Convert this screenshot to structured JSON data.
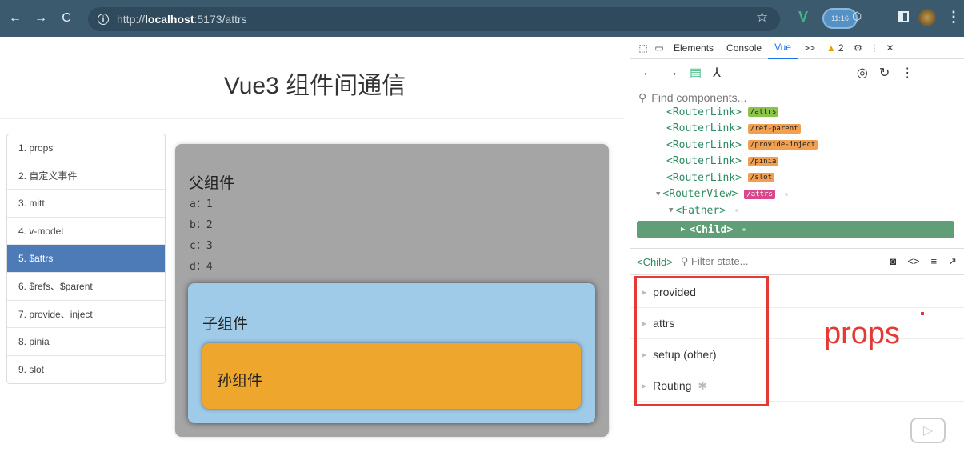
{
  "browser": {
    "back": "←",
    "forward": "→",
    "reload": "C",
    "url_prefix": "http://",
    "url_host": "localhost",
    "url_rest": ":5173/attrs",
    "star": "☆",
    "vue_ext": "V",
    "badge_time": "11:16",
    "menu": "⋮"
  },
  "page": {
    "title": "Vue3 组件间通信",
    "nav": [
      "1. props",
      "2. 自定义事件",
      "3. mitt",
      "4. v-model",
      "5. $attrs",
      "6. $refs、$parent",
      "7. provide、inject",
      "8. pinia",
      "9. slot"
    ],
    "active_index": 4,
    "father": {
      "title": "父组件",
      "items": [
        "a：1",
        "b：2",
        "c：3",
        "d：4"
      ]
    },
    "child": {
      "title": "子组件"
    },
    "grandchild": {
      "title": "孙组件"
    }
  },
  "devtools": {
    "tabs": [
      "Elements",
      "Console",
      "Vue",
      ">>"
    ],
    "active_tab": "Vue",
    "warning_count": "2",
    "search_placeholder": "Find components...",
    "tree": [
      {
        "label": "<RouterLink>",
        "tag": "/attrs",
        "color": "green"
      },
      {
        "label": "<RouterLink>",
        "tag": "/ref-parent",
        "color": "orange"
      },
      {
        "label": "<RouterLink>",
        "tag": "/provide-inject",
        "color": "orange"
      },
      {
        "label": "<RouterLink>",
        "tag": "/pinia",
        "color": "orange"
      },
      {
        "label": "<RouterLink>",
        "tag": "/slot",
        "color": "orange"
      },
      {
        "label": "<RouterView>",
        "tag": "/attrs",
        "color": "pink"
      },
      {
        "label": "<Father>",
        "tag": "",
        "color": ""
      }
    ],
    "selected": "<Child>",
    "state_component": "<Child>",
    "filter_placeholder": "Filter state...",
    "state_sections": [
      "provided",
      "attrs",
      "setup (other)",
      "Routing"
    ]
  },
  "annotation": {
    "note": "props",
    "color": "#e53935"
  }
}
